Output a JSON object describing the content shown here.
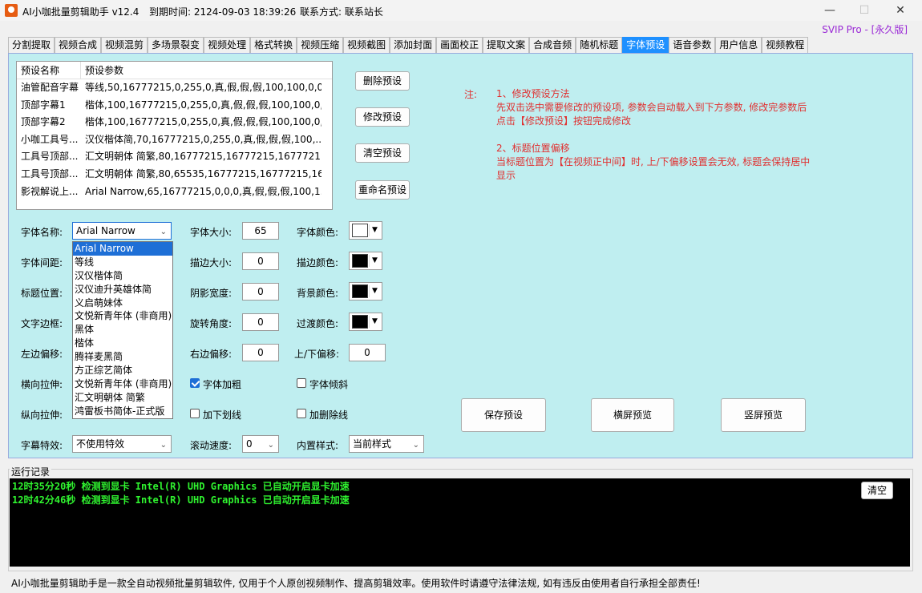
{
  "title": {
    "app_name": "AI小咖批量剪辑助手 v12.4",
    "expiry": "到期时间: 2124-09-03 18:39:26",
    "contact": "联系方式: 联系站长",
    "svip": "SVIP Pro - [永久版]",
    "minimize": "—",
    "maximize": "☐",
    "close": "✕"
  },
  "tabs": [
    "分割提取",
    "视频合成",
    "视频混剪",
    "多场景裂变",
    "视频处理",
    "格式转换",
    "视频压缩",
    "视频截图",
    "添加封面",
    "画面校正",
    "提取文案",
    "合成音频",
    "随机标题",
    "字体预设",
    "语音参数",
    "用户信息",
    "视频教程"
  ],
  "active_tab": "字体预设",
  "preset_list": {
    "col_name": "预设名称",
    "col_params": "预设参数",
    "rows": [
      {
        "name": "油管配音字幕",
        "params": "等线,50,16777215,0,255,0,真,假,假,假,100,100,0,0,..."
      },
      {
        "name": "顶部字幕1",
        "params": "楷体,100,16777215,0,255,0,真,假,假,假,100,100,0,0,..."
      },
      {
        "name": "顶部字幕2",
        "params": "楷体,100,16777215,0,255,0,真,假,假,假,100,100,0,0,..."
      },
      {
        "name": "小咖工具号...",
        "params": "汉仪楷体简,70,16777215,0,255,0,真,假,假,假,100,..."
      },
      {
        "name": "工具号顶部...",
        "params": "汇文明朝体 简繁,80,16777215,16777215,1677721..."
      },
      {
        "name": "工具号顶部...",
        "params": "汇文明朝体 简繁,80,65535,16777215,16777215,16..."
      },
      {
        "name": "影视解说上...",
        "params": "Arial Narrow,65,16777215,0,0,0,真,假,假,假,100,1..."
      }
    ]
  },
  "buttons": {
    "delete": "删除预设",
    "modify": "修改预设",
    "clear": "清空预设",
    "rename": "重命名预设",
    "save": "保存预设",
    "landscape": "横屏预览",
    "portrait": "竖屏预览",
    "clear_log": "清空"
  },
  "notes": {
    "label": "注:",
    "line1": "1、修改预设方法",
    "line2": "先双击选中需要修改的预设项, 参数会自动载入到下方参数, 修改完参数后",
    "line3": "点击【修改预设】按钮完成修改",
    "line4": "2、标题位置偏移",
    "line5": "当标题位置为【在视频正中间】时, 上/下偏移设置会无效, 标题会保持居中",
    "line6": "显示"
  },
  "form": {
    "font_name_label": "字体名称:",
    "font_name_value": "Arial Narrow",
    "font_spacing_label": "字体间距:",
    "title_pos_label": "标题位置:",
    "text_border_label": "文字边框:",
    "left_offset_label": "左边偏移:",
    "h_stretch_label": "横向拉伸:",
    "v_stretch_label": "纵向拉伸:",
    "effect_label": "字幕特效:",
    "effect_value": "不使用特效",
    "font_size_label": "字体大小:",
    "font_size_value": "65",
    "outline_size_label": "描边大小:",
    "outline_size_value": "0",
    "shadow_width_label": "阴影宽度:",
    "shadow_width_value": "0",
    "rotate_label": "旋转角度:",
    "rotate_value": "0",
    "right_offset_label": "右边偏移:",
    "right_offset_value": "0",
    "bold_label": "字体加粗",
    "underline_label": "加下划线",
    "scroll_speed_label": "滚动速度:",
    "scroll_speed_value": "0",
    "font_color_label": "字体颜色:",
    "outline_color_label": "描边颜色:",
    "bg_color_label": "背景颜色:",
    "transition_color_label": "过渡颜色:",
    "updown_offset_label": "上/下偏移:",
    "updown_offset_value": "0",
    "italic_label": "字体倾斜",
    "strike_label": "加删除线",
    "builtin_style_label": "内置样式:",
    "builtin_style_value": "当前样式"
  },
  "colors": {
    "font_color": "#ffffff",
    "outline_color": "#000000",
    "bg_color": "#000000",
    "transition_color": "#000000"
  },
  "checkboxes": {
    "bold": true,
    "italic": false,
    "underline": false,
    "strike": false
  },
  "font_dropdown": [
    "Arial Narrow",
    "等线",
    "汉仪楷体简",
    "汉仪迪升英雄体简",
    "义启萌妹体",
    "文悦新青年体 (非商用)",
    "黑体",
    "楷体",
    "腾祥麦黑简",
    "方正综艺简体",
    "文悦新青年体 (非商用)",
    "汇文明朝体 简繁",
    "鸿雷板书简体-正式版"
  ],
  "log": {
    "title": "运行记录",
    "lines": [
      "12时35分20秒 检测到显卡 Intel(R) UHD Graphics 已自动开启显卡加速",
      "12时42分46秒 检测到显卡 Intel(R) UHD Graphics 已自动开启显卡加速"
    ]
  },
  "status": "AI小咖批量剪辑助手是一款全自动视频批量剪辑软件, 仅用于个人原创视频制作、提高剪辑效率。使用软件时请遵守法律法规, 如有违反由使用者自行承担全部责任!"
}
